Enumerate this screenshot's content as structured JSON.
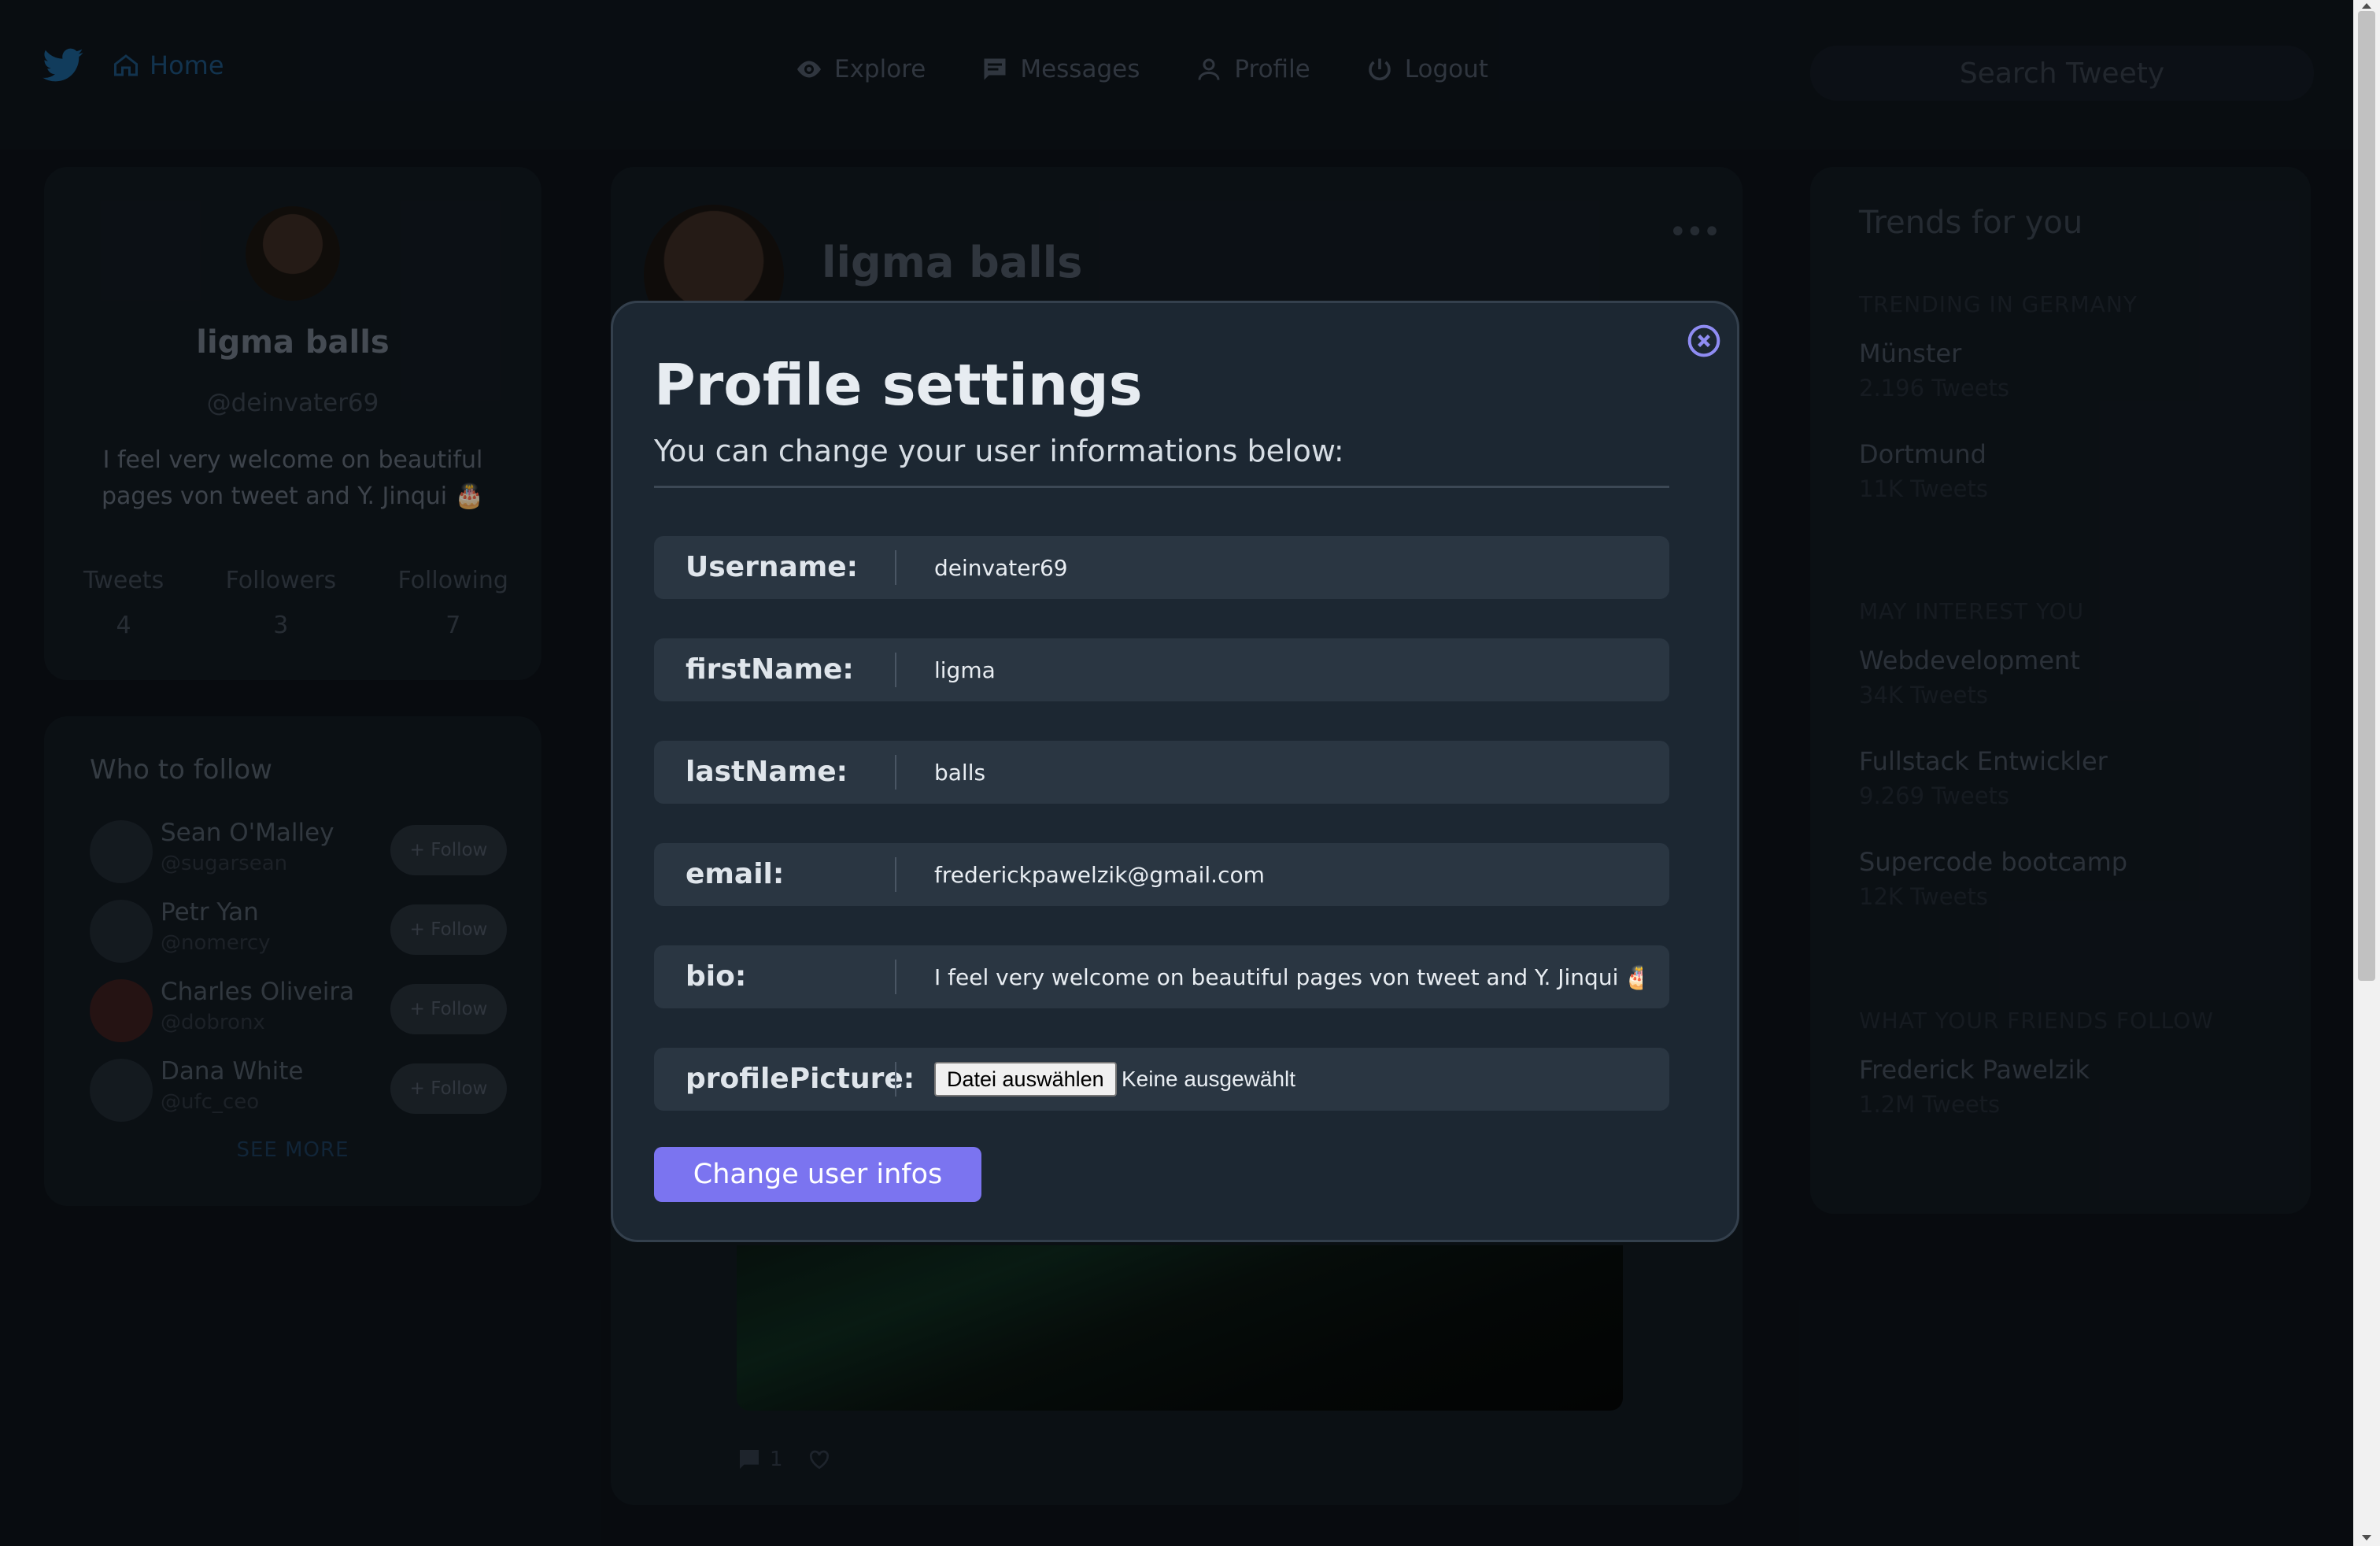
{
  "nav": {
    "home": "Home",
    "links": [
      "Explore",
      "Messages",
      "Profile",
      "Logout"
    ],
    "search_placeholder": "Search Tweety"
  },
  "profile_card": {
    "name": "ligma balls",
    "handle": "@deinvater69",
    "bio": "I feel very welcome on beautiful pages von tweet and Y. Jinqui 🎂",
    "stats": [
      {
        "label": "Tweets",
        "value": "4"
      },
      {
        "label": "Followers",
        "value": "3"
      },
      {
        "label": "Following",
        "value": "7"
      }
    ]
  },
  "who_to_follow": {
    "title": "Who to follow",
    "follow_label": "+ Follow",
    "users": [
      {
        "name": "Sean O'Malley",
        "handle": "@sugarsean"
      },
      {
        "name": "Petr Yan",
        "handle": "@nomercy"
      },
      {
        "name": "Charles Oliveira",
        "handle": "@dobronx"
      },
      {
        "name": "Dana White",
        "handle": "@ufc_ceo"
      }
    ],
    "see_more": "SEE MORE"
  },
  "feed": {
    "name": "ligma balls",
    "more": "•••",
    "comments": "1"
  },
  "trends": {
    "title": "Trends for you",
    "sections": [
      {
        "heading": "TRENDING IN GERMANY",
        "items": [
          {
            "name": "Münster",
            "count": "2.196 Tweets"
          },
          {
            "name": "Dortmund",
            "count": "11K Tweets"
          }
        ]
      },
      {
        "heading": "MAY INTEREST YOU",
        "items": [
          {
            "name": "Webdevelopment",
            "count": "34K Tweets"
          },
          {
            "name": "Fullstack Entwickler",
            "count": "9.269 Tweets"
          },
          {
            "name": "Supercode bootcamp",
            "count": "12K Tweets"
          }
        ]
      },
      {
        "heading": "WHAT YOUR FRIENDS FOLLOW",
        "items": [
          {
            "name": "Frederick Pawelzik",
            "count": "1.2M Tweets"
          }
        ]
      }
    ]
  },
  "modal": {
    "title": "Profile settings",
    "subtitle": "You can change your user informations below:",
    "fields": [
      {
        "label": "Username:",
        "value": "deinvater69"
      },
      {
        "label": "firstName:",
        "value": "ligma"
      },
      {
        "label": "lastName:",
        "value": "balls"
      },
      {
        "label": "email:",
        "value": "frederickpawelzik@gmail.com"
      },
      {
        "label": "bio:",
        "value": "I feel very welcome on beautiful pages von tweet and Y. Jinqui 🎂"
      }
    ],
    "picture": {
      "label": "profilePicture:",
      "button": "Datei auswählen",
      "status": "Keine ausgewählt"
    },
    "submit": "Change user infos"
  },
  "colors": {
    "accent": "#7b74f0",
    "modal_bg": "#1c2732",
    "field_bg": "#2a3642",
    "twitter_blue": "#1d9bf0"
  }
}
